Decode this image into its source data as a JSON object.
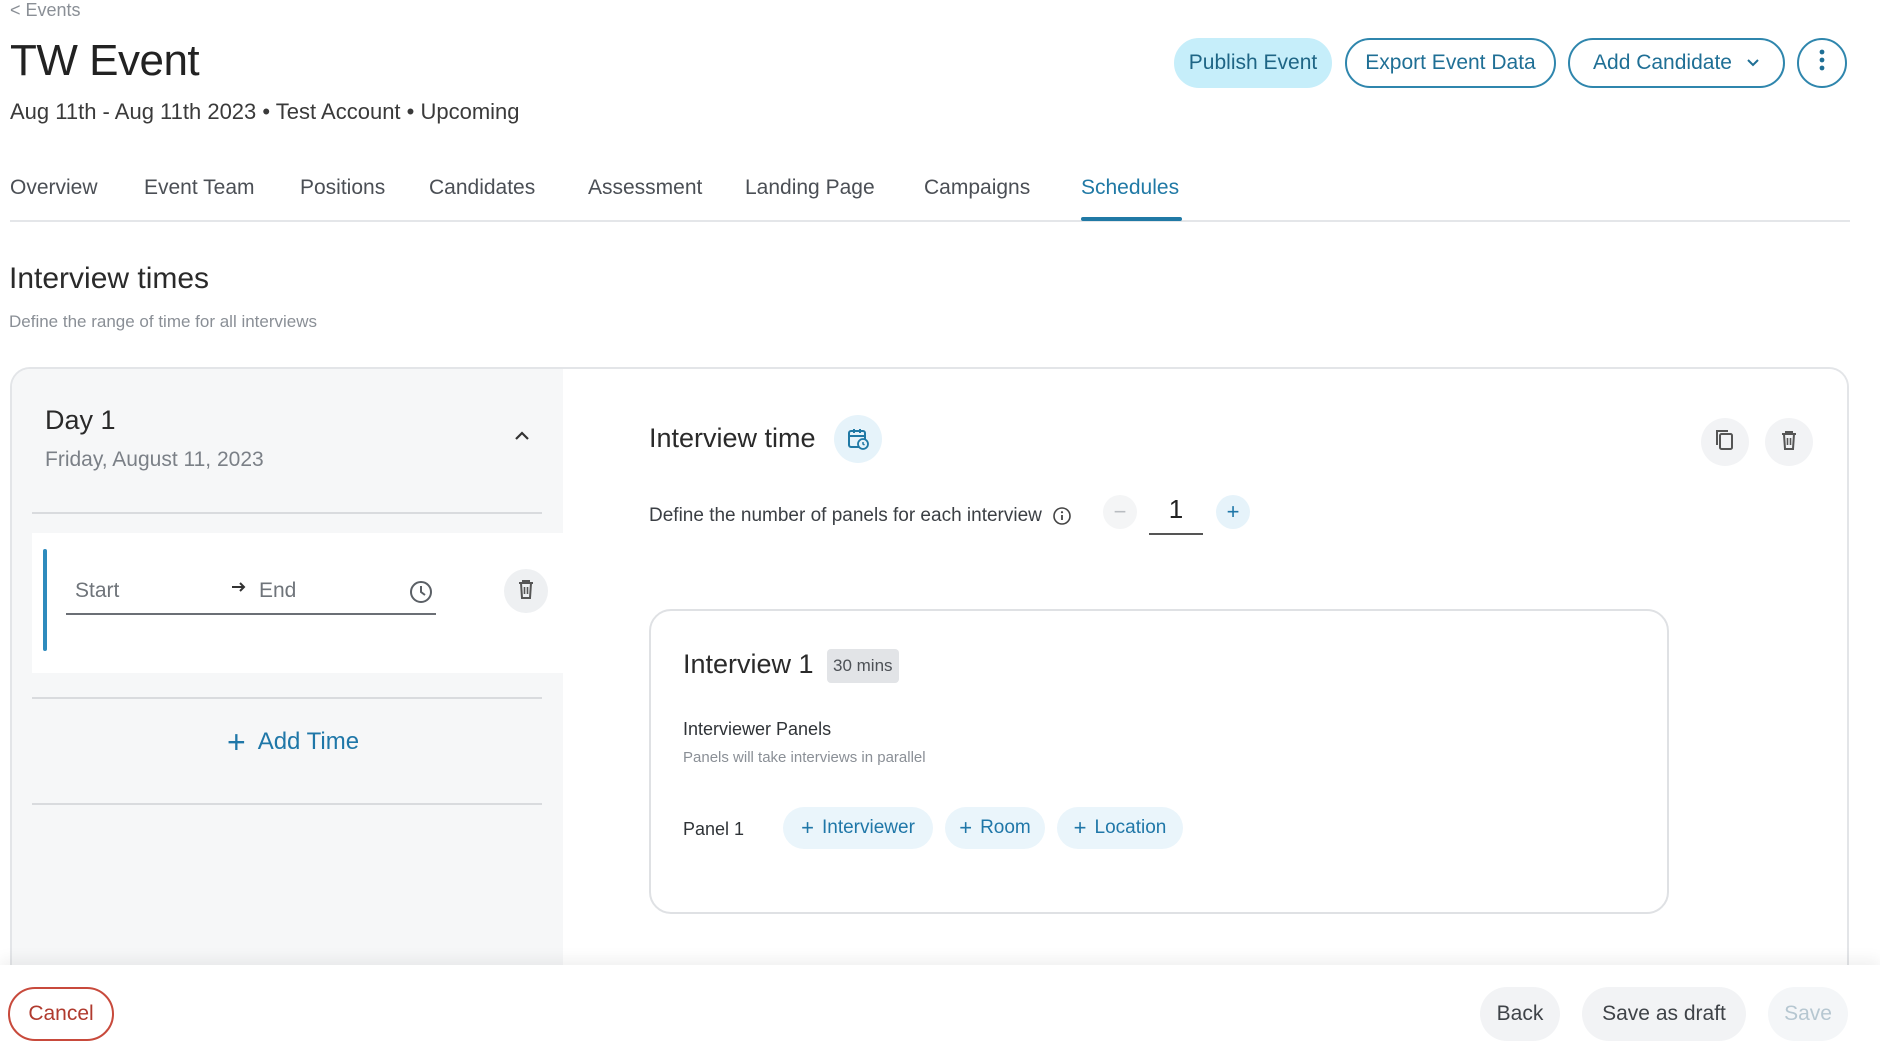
{
  "breadcrumb": {
    "back_label": "< Events"
  },
  "event": {
    "title": "TW Event",
    "subtitle": "Aug 11th - Aug 11th 2023 • Test Account • Upcoming"
  },
  "actions": {
    "publish": "Publish Event",
    "export": "Export Event Data",
    "add_candidate": "Add Candidate"
  },
  "tabs": [
    {
      "label": "Overview"
    },
    {
      "label": "Event Team"
    },
    {
      "label": "Positions"
    },
    {
      "label": "Candidates"
    },
    {
      "label": "Assessment"
    },
    {
      "label": "Landing Page"
    },
    {
      "label": "Campaigns"
    },
    {
      "label": "Schedules",
      "active": true
    }
  ],
  "section": {
    "title": "Interview times",
    "subtitle": "Define the range of time for all interviews"
  },
  "day": {
    "title": "Day 1",
    "date": "Friday, August 11, 2023",
    "start_placeholder": "Start",
    "end_placeholder": "End",
    "add_time": "Add Time"
  },
  "interview_time": {
    "title": "Interview time",
    "panels_label": "Define the number of panels for each interview",
    "panel_count": "1",
    "minus": "−",
    "plus": "+"
  },
  "interview": {
    "title": "Interview 1",
    "duration": "30 mins",
    "panels_title": "Interviewer Panels",
    "panels_sub": "Panels will take interviews in parallel",
    "panel_label": "Panel 1",
    "chips": {
      "interviewer": "Interviewer",
      "room": "Room",
      "location": "Location"
    }
  },
  "footer": {
    "cancel": "Cancel",
    "back": "Back",
    "save_draft": "Save as draft",
    "save": "Save"
  },
  "colors": {
    "accent": "#2079a5",
    "publish_bg": "#c6eefa",
    "cancel": "#c84a3c"
  }
}
